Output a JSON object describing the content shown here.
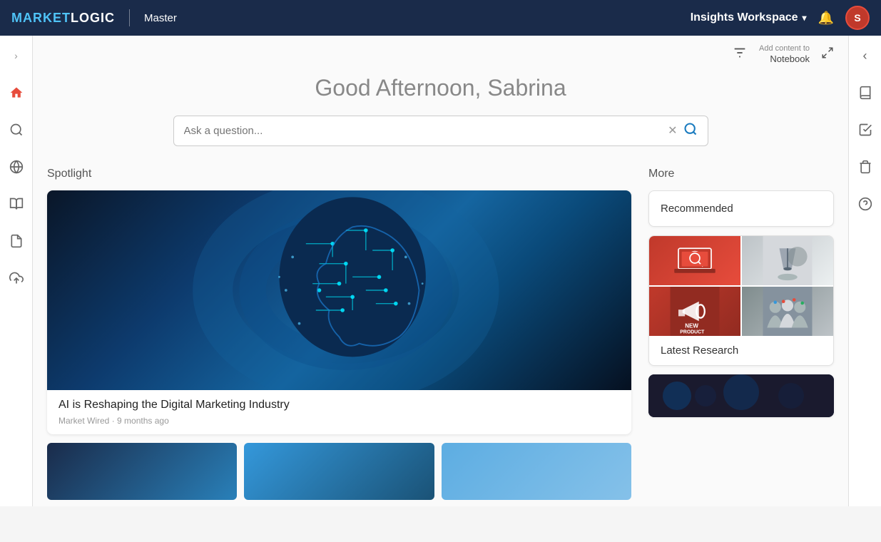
{
  "app": {
    "name": "MARKETLOGIC",
    "separator": "|",
    "instance": "Master"
  },
  "header": {
    "workspace_label": "Insights Workspace",
    "bell_label": "🔔",
    "avatar_initials": "S"
  },
  "toolbar": {
    "add_content_label": "Add content to",
    "notebook_label": "Notebook"
  },
  "greeting": "Good Afternoon, Sabrina",
  "search": {
    "placeholder": "Ask a question..."
  },
  "spotlight": {
    "section_title": "Spotlight",
    "card": {
      "title": "AI is Reshaping the Digital Marketing Industry",
      "source": "Market Wired",
      "time_ago": "9 months ago"
    }
  },
  "more": {
    "section_title": "More",
    "cards": [
      {
        "id": "recommended",
        "label": "Recommended"
      },
      {
        "id": "latest-research",
        "label": "Latest Research"
      }
    ]
  },
  "sidebar_left": {
    "items": [
      {
        "id": "expand",
        "icon": "›",
        "label": "expand-icon"
      },
      {
        "id": "home",
        "icon": "⌂",
        "label": "home-icon",
        "active": true
      },
      {
        "id": "search",
        "icon": "⚲",
        "label": "search-icon"
      },
      {
        "id": "globe",
        "icon": "⊕",
        "label": "globe-icon"
      },
      {
        "id": "learn",
        "icon": "🎓",
        "label": "learn-icon"
      },
      {
        "id": "reports",
        "icon": "📄",
        "label": "reports-icon"
      },
      {
        "id": "upload",
        "icon": "⬆",
        "label": "upload-icon"
      }
    ]
  },
  "sidebar_right": {
    "items": [
      {
        "id": "collapse",
        "icon": "‹",
        "label": "collapse-icon"
      },
      {
        "id": "book",
        "icon": "📖",
        "label": "book-icon"
      },
      {
        "id": "checklist",
        "icon": "✓",
        "label": "checklist-icon"
      },
      {
        "id": "trash",
        "icon": "🗑",
        "label": "trash-icon"
      },
      {
        "id": "help",
        "icon": "?",
        "label": "help-icon"
      }
    ]
  }
}
